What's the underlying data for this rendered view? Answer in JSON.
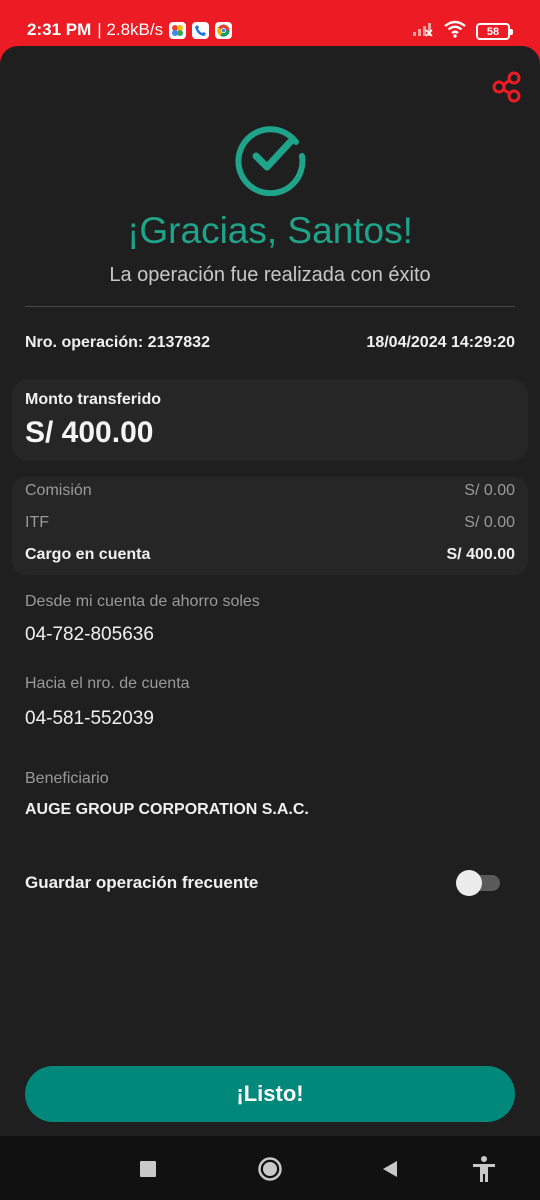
{
  "status_bar": {
    "time": "2:31 PM",
    "network_speed": "| 2.8kB/s",
    "battery": "58",
    "icons": [
      "photos-icon",
      "phone-icon",
      "chrome-icon",
      "signal-icon",
      "wifi-icon",
      "battery-icon"
    ]
  },
  "header": {
    "share_icon": "share-icon",
    "success_icon": "check-circle-icon",
    "title": "¡Gracias, Santos!",
    "subtitle": "La operación fue realizada con éxito"
  },
  "operation": {
    "number_label": "Nro. operación: 2137832",
    "datetime": "18/04/2024 14:29:20"
  },
  "amount": {
    "label": "Monto transferido",
    "value": "S/ 400.00"
  },
  "fees": [
    {
      "label": "Comisión",
      "value": "S/ 0.00"
    },
    {
      "label": "ITF",
      "value": "S/ 0.00"
    },
    {
      "label": "Cargo en cuenta",
      "value": "S/ 400.00"
    }
  ],
  "from_account": {
    "label": "Desde mi cuenta de ahorro soles",
    "value": "04-782-805636"
  },
  "to_account": {
    "label": "Hacia el nro. de cuenta",
    "value": "04-581-552039"
  },
  "beneficiary": {
    "label": "Beneficiario",
    "value": "AUGE GROUP CORPORATION S.A.C."
  },
  "frequent": {
    "label": "Guardar operación frecuente",
    "enabled": false
  },
  "actions": {
    "done_label": "¡Listo!"
  },
  "colors": {
    "brand_red": "#ed1c24",
    "success_green": "#1fa38a",
    "button_green": "#00887a",
    "background": "#1f1f1f"
  }
}
